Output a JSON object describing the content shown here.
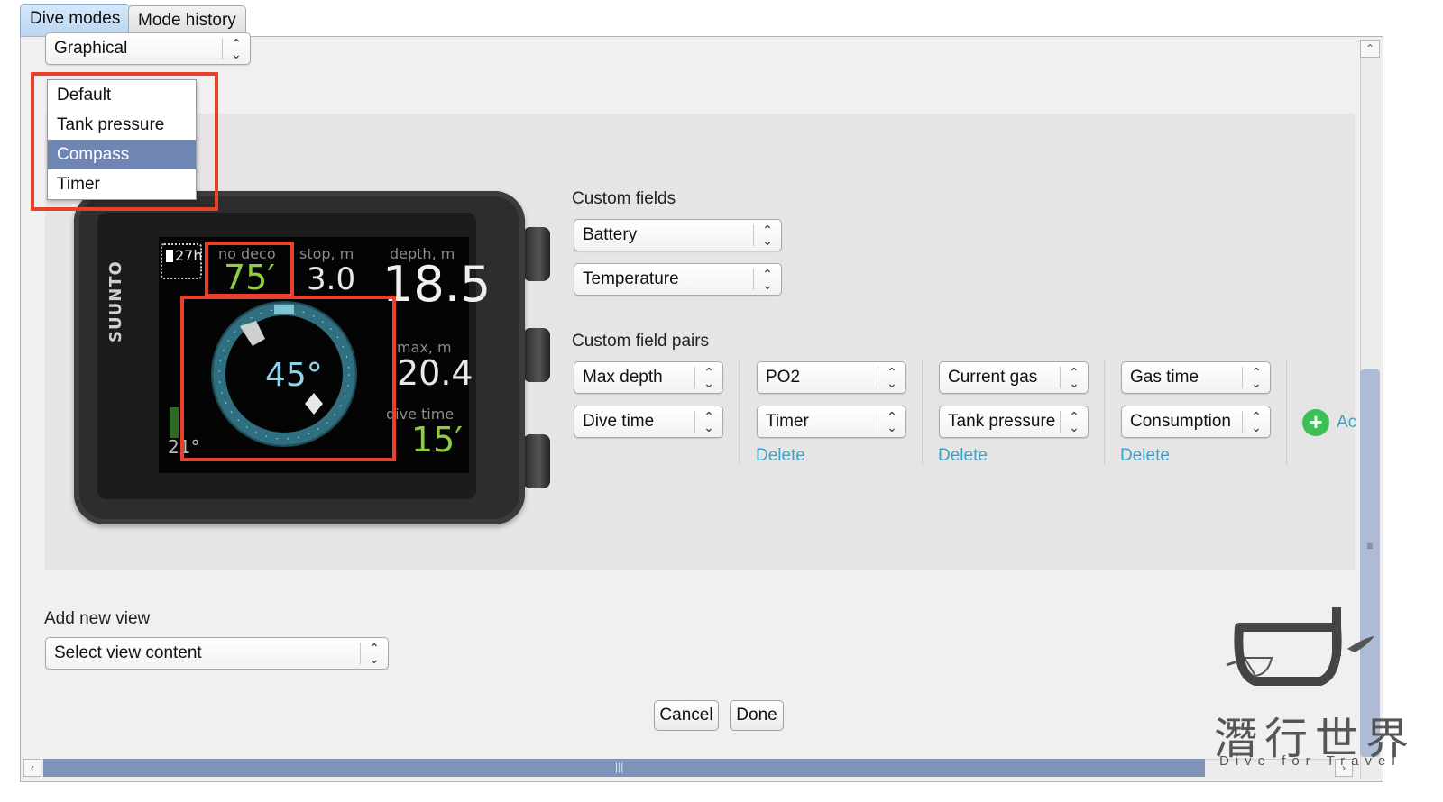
{
  "tabs": [
    {
      "label": "Dive modes"
    },
    {
      "label": "Mode history"
    }
  ],
  "view_type_select": {
    "value": "Graphical"
  },
  "dropdown": {
    "items": [
      "Default",
      "Tank pressure",
      "Compass",
      "Timer"
    ],
    "selected": "Compass"
  },
  "device": {
    "brand": "SUUNTO",
    "battery": "27h",
    "no_deco_label": "no deco",
    "no_deco_value": "75′",
    "stop_label": "stop, m",
    "stop_value": "3.0",
    "depth_label": "depth, m",
    "depth_value": "18.5",
    "heading": "45°",
    "max_label": "max, m",
    "max_value": "20.4",
    "dive_time_label": "dive time",
    "dive_time_value": "15′",
    "temp_value": "21°"
  },
  "custom_fields": {
    "title": "Custom fields",
    "fields": [
      "Battery",
      "Temperature"
    ]
  },
  "custom_field_pairs": {
    "title": "Custom field pairs",
    "pairs": [
      {
        "top": "Max depth",
        "bottom": "Dive time",
        "delete": ""
      },
      {
        "top": "PO2",
        "bottom": "Timer",
        "delete": "Delete"
      },
      {
        "top": "Current gas",
        "bottom": "Tank pressure",
        "delete": "Delete"
      },
      {
        "top": "Gas time",
        "bottom": "Consumption",
        "delete": "Delete"
      }
    ],
    "add_label": "Ac"
  },
  "add_new_view": {
    "title": "Add new view",
    "select_value": "Select view content"
  },
  "buttons": {
    "cancel": "Cancel",
    "done": "Done"
  },
  "watermark": {
    "chinese": "潛行世界",
    "english": "Dive for Travel"
  },
  "colors": {
    "highlight_red": "#e8402a",
    "delete_link": "#3aa3c9",
    "selected_item": "#6f86b5",
    "add_green": "#3cc055"
  }
}
